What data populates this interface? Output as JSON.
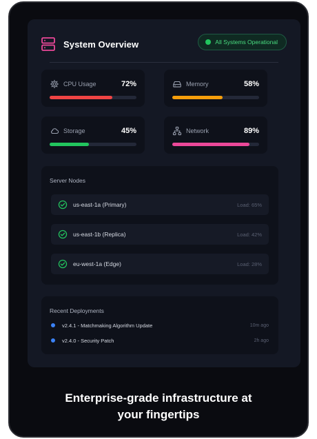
{
  "header": {
    "title": "System Overview",
    "status": "All Systems Operational",
    "icon": "server-icon"
  },
  "metrics": [
    {
      "label": "CPU Usage",
      "value": "72%",
      "fill": 0.72,
      "color": "#ef4444",
      "icon": "cpu-gear-icon"
    },
    {
      "label": "Memory",
      "value": "58%",
      "fill": 0.58,
      "color": "#f59e0b",
      "icon": "hard-drive-icon"
    },
    {
      "label": "Storage",
      "value": "45%",
      "fill": 0.45,
      "color": "#22c55e",
      "icon": "cloud-icon"
    },
    {
      "label": "Network",
      "value": "89%",
      "fill": 0.89,
      "color": "#ec4899",
      "icon": "network-icon"
    }
  ],
  "server_nodes": {
    "title": "Server Nodes",
    "items": [
      {
        "name": "us-east-1a (Primary)",
        "load": "Load: 65%"
      },
      {
        "name": "us-east-1b (Replica)",
        "load": "Load: 42%"
      },
      {
        "name": "eu-west-1a (Edge)",
        "load": "Load: 28%"
      }
    ]
  },
  "deployments": {
    "title": "Recent Deployments",
    "items": [
      {
        "text": "v2.4.1 - Matchmaking Algorithm Update",
        "time": "10m ago"
      },
      {
        "text": "v2.4.0 - Security Patch",
        "time": "2h ago"
      }
    ]
  },
  "tagline": {
    "line1": "Enterprise-grade infrastructure at",
    "line2": "your fingertips"
  }
}
